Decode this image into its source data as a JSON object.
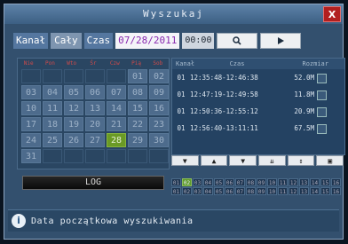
{
  "window": {
    "title": "Wyszukaj",
    "close_label": "X"
  },
  "search": {
    "kanal_label": "Kanał",
    "kanal_value": "Cały",
    "czas_label": "Czas",
    "date_value": "07/28/2011",
    "time_value": "00:00",
    "search_icon": "magnifier-icon",
    "play_icon": "play-icon"
  },
  "calendar": {
    "day_names": [
      "Nie",
      "Pon",
      "Wto",
      "Śr",
      "Czw",
      "Pią",
      "Sob"
    ],
    "selected_day": "28",
    "cells": [
      "",
      "",
      "",
      "",
      "",
      "01",
      "02",
      "03",
      "04",
      "05",
      "06",
      "07",
      "08",
      "09",
      "10",
      "11",
      "12",
      "13",
      "14",
      "15",
      "16",
      "17",
      "18",
      "19",
      "20",
      "21",
      "22",
      "23",
      "24",
      "25",
      "26",
      "27",
      "28",
      "29",
      "30",
      "31",
      "",
      "",
      "",
      "",
      "",
      ""
    ]
  },
  "list": {
    "headers": [
      "Kanał",
      "Czas",
      "Rozmiar"
    ],
    "rows": [
      {
        "ch": "01",
        "time": "12:35:48-12:46:38",
        "size": "52.0M"
      },
      {
        "ch": "01",
        "time": "12:47:19-12:49:58",
        "size": "11.8M"
      },
      {
        "ch": "01",
        "time": "12:50:36-12:55:12",
        "size": "20.9M"
      },
      {
        "ch": "01",
        "time": "12:56:40-13:11:11",
        "size": "67.5M"
      }
    ]
  },
  "actions": [
    "▼",
    "▲",
    "▼",
    "⇊",
    "↕",
    "▣"
  ],
  "log_button": "LOG",
  "channels": [
    "01",
    "02",
    "03",
    "04",
    "05",
    "06",
    "07",
    "08",
    "09",
    "10",
    "11",
    "12",
    "13",
    "14",
    "15",
    "16",
    "01",
    "02",
    "03",
    "04",
    "05",
    "06",
    "07",
    "08",
    "09",
    "10",
    "11",
    "12",
    "13",
    "14",
    "15",
    "16"
  ],
  "channel_on_index": 1,
  "status_text": "Data początkowa wyszukiwania"
}
